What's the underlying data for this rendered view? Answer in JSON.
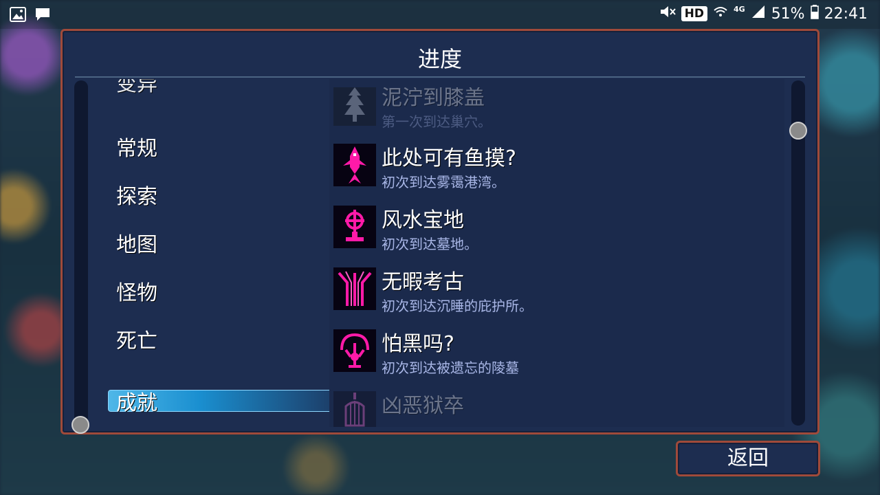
{
  "status_bar": {
    "left_icons": [
      "gallery-icon",
      "message-icon"
    ],
    "hd": "HD",
    "network": "4G",
    "battery": "51%",
    "time": "22:41"
  },
  "panel": {
    "title": "进度"
  },
  "categories": [
    {
      "label": "变异",
      "selected": false
    },
    {
      "label": "常规",
      "selected": false
    },
    {
      "label": "探索",
      "selected": false
    },
    {
      "label": "地图",
      "selected": false
    },
    {
      "label": "怪物",
      "selected": false
    },
    {
      "label": "死亡",
      "selected": false
    },
    {
      "label": "成就",
      "selected": true
    }
  ],
  "achievements": [
    {
      "name": "泥泞到膝盖",
      "desc": "第一次到达巢穴。",
      "unlocked": false,
      "icon": "tree-icon"
    },
    {
      "name": "此处可有鱼摸?",
      "desc": "初次到达雾霭港湾。",
      "unlocked": true,
      "icon": "fish-icon"
    },
    {
      "name": "风水宝地",
      "desc": "初次到达墓地。",
      "unlocked": true,
      "icon": "grave-cross-icon"
    },
    {
      "name": "无暇考古",
      "desc": "初次到达沉睡的庇护所。",
      "unlocked": true,
      "icon": "tripod-icon"
    },
    {
      "name": "怕黑吗?",
      "desc": "初次到达被遗忘的陵墓",
      "unlocked": true,
      "icon": "skull-tree-icon"
    },
    {
      "name": "凶恶狱卒",
      "desc": "",
      "unlocked": false,
      "icon": "cage-icon"
    }
  ],
  "back_button": {
    "label": "返回"
  },
  "colors": {
    "panel_bg": "#1d2d50",
    "panel_border": "#a04a3a",
    "accent_magenta": "#ff1aa8",
    "selected_blue": "#1a8fd0",
    "desc_text": "#a8b6e6"
  }
}
